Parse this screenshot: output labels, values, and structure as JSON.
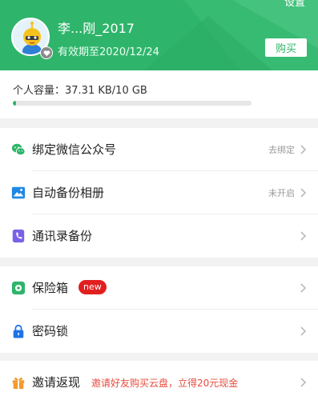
{
  "header": {
    "settings_label": "设置",
    "username": "李...刚_2017",
    "expiry_text": "有效期至2020/12/24",
    "buy_label": "购买",
    "avatar_icon": "cartoon-mascot-icon",
    "vip_icon": "vip-heart-icon"
  },
  "capacity": {
    "label": "个人容量：37.31 KB/10 GB",
    "used_fraction": 0.014
  },
  "menu": {
    "wechat": {
      "label": "绑定微信公众号",
      "status": "去绑定",
      "icon": "wechat-icon"
    },
    "album": {
      "label": "自动备份相册",
      "status": "未开启",
      "icon": "photo-icon"
    },
    "contacts": {
      "label": "通讯录备份",
      "icon": "contacts-book-icon"
    },
    "safe": {
      "label": "保险箱",
      "badge": "new",
      "icon": "safe-box-icon"
    },
    "lock": {
      "label": "密码锁",
      "icon": "lock-icon"
    },
    "invite": {
      "label": "邀请返现",
      "promo": "邀请好友购买云盘，立得20元现金",
      "icon": "gift-icon"
    }
  },
  "colors": {
    "brand_green": "#2fb56b",
    "album_blue": "#1e88e5",
    "contacts_purple": "#7b61e8",
    "lock_blue": "#1e73e8",
    "gift_orange": "#f39a2c",
    "badge_red": "#e21f1f",
    "promo_red": "#e84c3d"
  }
}
